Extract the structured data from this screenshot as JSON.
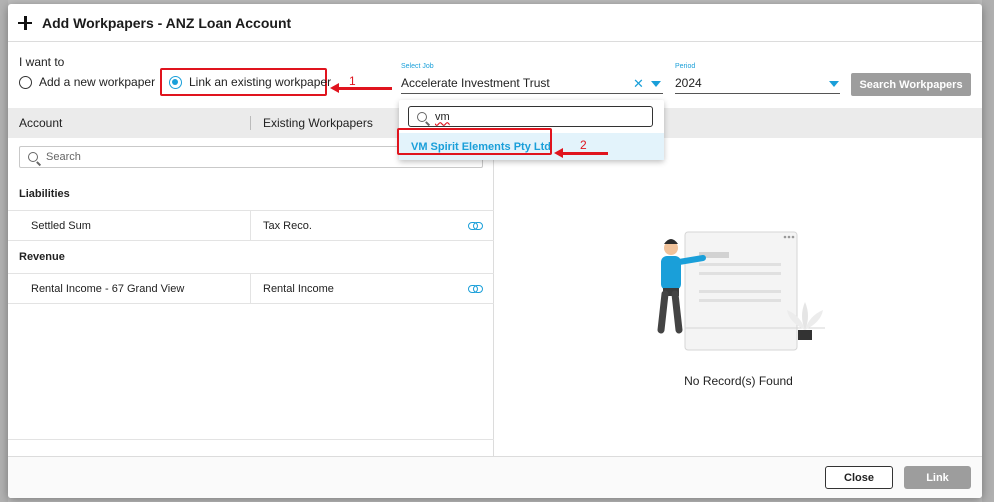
{
  "modal": {
    "title": "Add Workpapers - ANZ Loan Account"
  },
  "options": {
    "i_want_to": "I want to",
    "add_new": "Add a new workpaper",
    "link_existing": "Link an existing workpaper",
    "selected": "link_existing"
  },
  "job": {
    "caption": "Select Job",
    "value": "Accelerate Investment Trust"
  },
  "period": {
    "caption": "Period",
    "value": "2024"
  },
  "search_workpapers_label": "Search Workpapers",
  "dropdown": {
    "search_value": "vm",
    "options": [
      "VM Spirit Elements Pty Ltd"
    ]
  },
  "grid": {
    "col_account": "Account",
    "col_existing": "Existing Workpapers",
    "search_placeholder": "Search",
    "groups": [
      {
        "label": "Liabilities",
        "rows": [
          {
            "account": "Settled Sum",
            "workpaper": "Tax Reco."
          }
        ]
      },
      {
        "label": "Revenue",
        "rows": [
          {
            "account": "Rental Income - 67 Grand View",
            "workpaper": "Rental Income"
          }
        ]
      }
    ]
  },
  "right_panel": {
    "empty_text": "No Record(s) Found"
  },
  "footer": {
    "close_label": "Close",
    "link_label": "Link"
  },
  "annotations": {
    "step1": "1",
    "step2": "2"
  },
  "colors": {
    "accent": "#1a9fd9",
    "annotation_red": "#e0141e",
    "disabled_button": "#9d9d9d"
  }
}
